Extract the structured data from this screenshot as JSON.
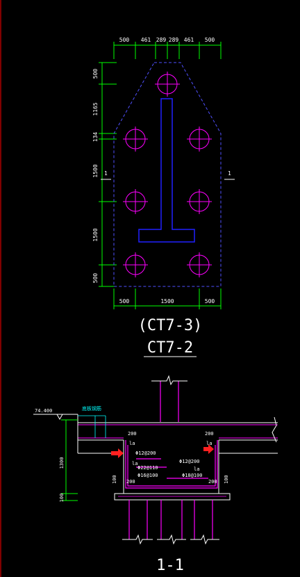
{
  "plan": {
    "top_dims": [
      "500",
      "461",
      "289",
      "289",
      "461",
      "500"
    ],
    "bottom_dims": [
      "500",
      "1500",
      "500"
    ],
    "left_dims": [
      "500",
      "1165",
      "134",
      "1500",
      "1500",
      "500"
    ],
    "section_mark_left": "1",
    "section_mark_right": "1",
    "title_main": "(CT7-3)",
    "title_sub": "CT7-2"
  },
  "section": {
    "elevation": "74.400",
    "cushion_note": "底板钢筋",
    "height_dims": [
      "1300",
      "100"
    ],
    "left_labels": [
      "200",
      "la"
    ],
    "right_labels": [
      "200",
      "la"
    ],
    "rebar_left_top": "Φ12@200",
    "rebar_left_mid1": "Φ22@110",
    "rebar_left_mid2": "Φ16@100",
    "rebar_right_top": "Φ12@200",
    "rebar_right_bottom": "Φ18@100",
    "inner_left_small": "la",
    "inner_right_small": "la",
    "inner_left_200": "200",
    "inner_right_200": "200",
    "side_left": "100",
    "side_right": "100",
    "title": "1-1"
  },
  "colors": {
    "background": "#000000",
    "dimension": "#00ff00",
    "pile": "#ff00ff",
    "outline": "#5050ff",
    "column": "#0000ff",
    "text": "#ffffff",
    "rebar": "#ff00ff",
    "arrow": "#ff2020"
  }
}
